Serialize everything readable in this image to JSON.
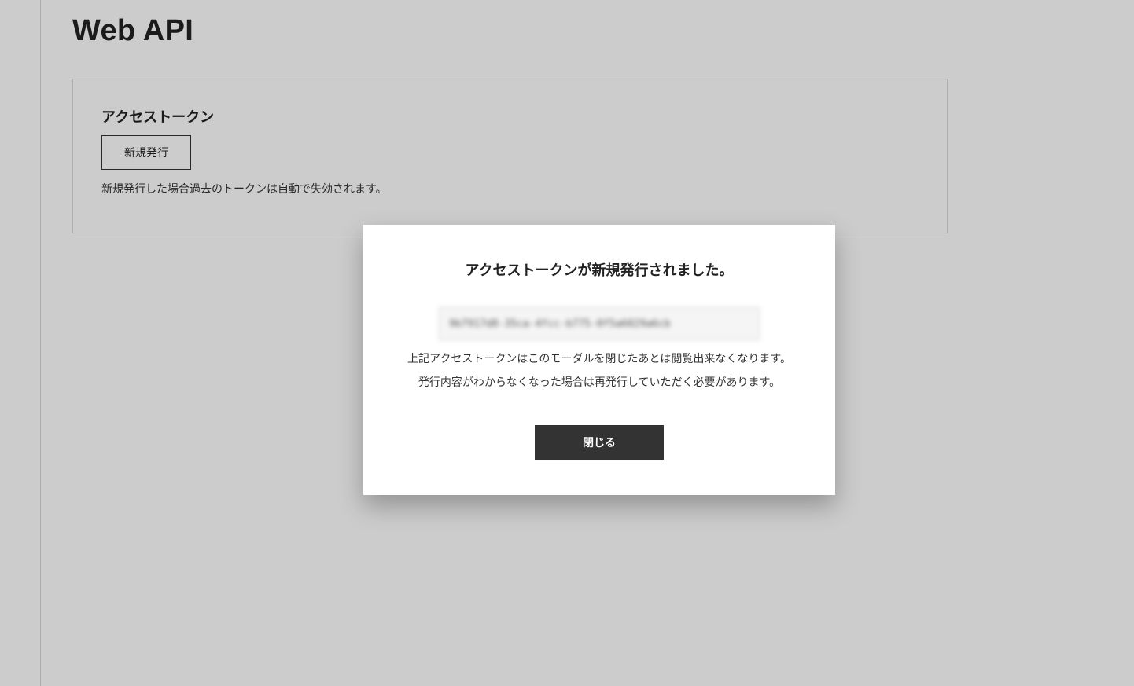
{
  "page": {
    "title": "Web API"
  },
  "card": {
    "title": "アクセストークン",
    "issue_button_label": "新規発行",
    "note": "新規発行した場合過去のトークンは自動で失効されます。"
  },
  "modal": {
    "title": "アクセストークンが新規発行されました。",
    "token_value": "9b7917d8-35ca-4fcc-b775-0f5a6029a6cb",
    "note_line1": "上記アクセストークンはこのモーダルを閉じたあとは閲覧出来なくなります。",
    "note_line2": "発行内容がわからなくなった場合は再発行していただく必要があります。",
    "close_button_label": "閉じる"
  },
  "colors": {
    "overlay": "rgba(0,0,0,0.2)",
    "primary_button": "#333333",
    "text": "#222222"
  }
}
